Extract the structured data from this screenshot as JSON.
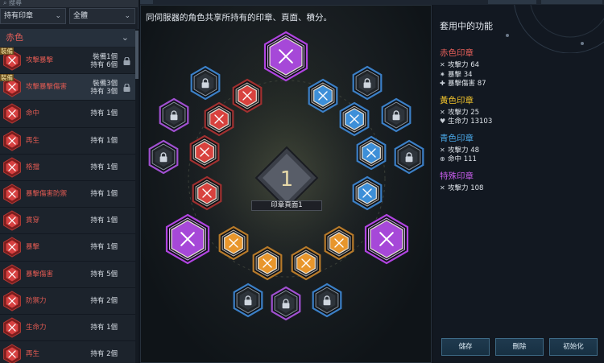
{
  "search": {
    "placeholder": "搜尋"
  },
  "filters": {
    "owned": "持有印章",
    "scope": "全體"
  },
  "category": {
    "label": "赤色"
  },
  "list": [
    {
      "name": "攻擊暴擊",
      "equip": "裝備1個",
      "own": "持有 6個",
      "locked": true,
      "badge": "裝備",
      "color": "#e84848",
      "icon": "crossed-swords-icon"
    },
    {
      "name": "攻擊暴擊傷害",
      "equip": "裝備3個",
      "own": "持有 3個",
      "locked": true,
      "badge": "裝備",
      "color": "#e84848",
      "icon": "crossed-swords-icon"
    },
    {
      "name": "命中",
      "own": "持有 1個",
      "color": "#e84848",
      "icon": "target-icon"
    },
    {
      "name": "再生",
      "own": "持有 1個",
      "color": "#e84848",
      "icon": "wings-icon"
    },
    {
      "name": "格擋",
      "own": "持有 1個",
      "color": "#e84848",
      "icon": "block-icon"
    },
    {
      "name": "暴擊傷害防禦",
      "own": "持有 1個",
      "color": "#e84848",
      "icon": "crossed-swords-icon"
    },
    {
      "name": "貫穿",
      "own": "持有 1個",
      "color": "#e84848",
      "icon": "pierce-icon"
    },
    {
      "name": "暴擊",
      "own": "持有 1個",
      "color": "#e84848",
      "icon": "burst-icon"
    },
    {
      "name": "暴擊傷害",
      "own": "持有 5個",
      "color": "#e84848",
      "icon": "cross-icon"
    },
    {
      "name": "防禦力",
      "own": "持有 2個",
      "color": "#e84848",
      "icon": "shield-icon"
    },
    {
      "name": "生命力",
      "own": "持有 1個",
      "color": "#e84848",
      "icon": "heart-shield-icon"
    },
    {
      "name": "再生",
      "own": "持有 2個",
      "color": "#e84848",
      "icon": "wings-icon"
    }
  ],
  "main": {
    "description": "同伺服器的角色共享所持有的印章、頁面、積分。",
    "page_number": "1",
    "page_label": "印章頁面1"
  },
  "right": {
    "title": "套用中的功能",
    "sections": [
      {
        "name": "赤色印章",
        "color": "#e8605a",
        "stats": [
          {
            "icon": "crossed-swords-icon",
            "text": "攻擊力 64"
          },
          {
            "icon": "burst-icon",
            "text": "暴擊 34"
          },
          {
            "icon": "cross-icon",
            "text": "暴擊傷害 87"
          }
        ]
      },
      {
        "name": "黃色印章",
        "color": "#f0c22c",
        "stats": [
          {
            "icon": "crossed-swords-icon",
            "text": "攻擊力 25"
          },
          {
            "icon": "heart-icon",
            "text": "生命力 13103"
          }
        ]
      },
      {
        "name": "青色印章",
        "color": "#4aa8e8",
        "stats": [
          {
            "icon": "crossed-swords-icon",
            "text": "攻擊力 48"
          },
          {
            "icon": "target-icon",
            "text": "命中 111"
          }
        ]
      },
      {
        "name": "特殊印章",
        "color": "#c45ce8",
        "stats": [
          {
            "icon": "crossed-swords-icon",
            "text": "攻擊力 108"
          }
        ]
      }
    ],
    "buttons": {
      "save": "儲存",
      "delete": "刪除",
      "reset": "初始化"
    }
  },
  "colors": {
    "red": "#d8423e",
    "blue": "#3d8fd8",
    "orange": "#e8962c",
    "purple": "#a648d8",
    "locked": "#6a7480"
  }
}
